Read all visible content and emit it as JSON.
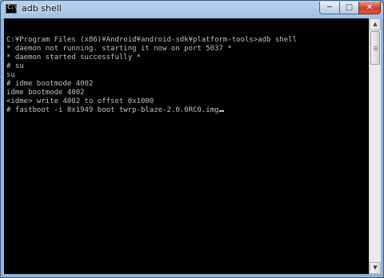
{
  "window": {
    "title": "adb shell",
    "icon_text": "C:\\",
    "minimize_glyph": "─",
    "maximize_glyph": "□",
    "close_glyph": "✕"
  },
  "console": {
    "lines": [
      "",
      "C:¥Program Files (x86)¥Android¥android-sdk¥platform-tools>adb shell",
      "* daemon not running. starting it now on port 5037 *",
      "* daemon started successfully *",
      "# su",
      "su",
      "# idme bootmode 4002",
      "idme bootmode 4002",
      "<idme> write 4002 to offset 0x1000",
      "# fastboot -i 0x1949 boot twrp-blaze-2.0.0RC0.img"
    ]
  },
  "scrollbar": {
    "up_glyph": "▲",
    "down_glyph": "▼"
  },
  "colors": {
    "console_bg": "#000000",
    "console_fg": "#c0c0c0",
    "close_button": "#c7412a"
  }
}
